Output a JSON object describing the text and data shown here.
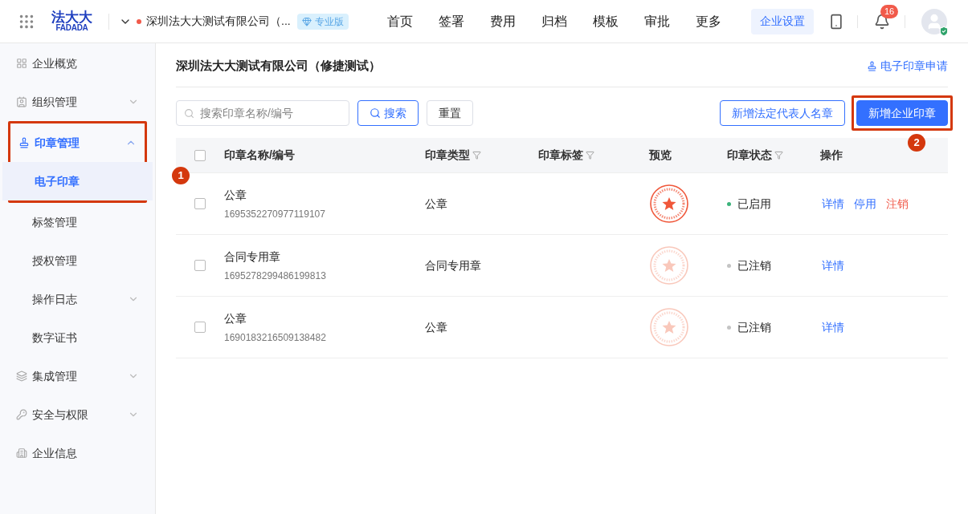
{
  "header": {
    "logo": {
      "top": "法大大",
      "bottom": "FADADA"
    },
    "company": "深圳法大大测试有限公司（...",
    "edition": "专业版",
    "nav": [
      {
        "label": "首页",
        "selected": false
      },
      {
        "label": "签署",
        "selected": false
      },
      {
        "label": "费用",
        "selected": false
      },
      {
        "label": "归档",
        "selected": false
      },
      {
        "label": "模板",
        "selected": false
      },
      {
        "label": "审批",
        "selected": false
      },
      {
        "label": "更多",
        "selected": false
      }
    ],
    "settings": "企业设置",
    "notifications": "16"
  },
  "sidebar": {
    "items": [
      {
        "label": "企业概览",
        "selected": false
      },
      {
        "label": "组织管理",
        "selected": false,
        "expanded": false
      },
      {
        "label": "印章管理",
        "selected": true,
        "expanded": true,
        "annotation": "1",
        "children": [
          {
            "label": "电子印章",
            "selected": true
          },
          {
            "label": "标签管理",
            "selected": false
          },
          {
            "label": "授权管理",
            "selected": false
          },
          {
            "label": "操作日志",
            "selected": false,
            "expanded": false
          },
          {
            "label": "数字证书",
            "selected": false
          }
        ]
      },
      {
        "label": "集成管理",
        "selected": false,
        "expanded": false
      },
      {
        "label": "安全与权限",
        "selected": false,
        "expanded": false
      },
      {
        "label": "企业信息",
        "selected": false
      }
    ]
  },
  "page": {
    "title": "深圳法大大测试有限公司（修捷测试）",
    "apply_link": "电子印章申请",
    "search": {
      "placeholder": "搜索印章名称/编号",
      "search_button": "搜索",
      "reset_button": "重置"
    },
    "buttons": [
      {
        "label": "新增法定代表人名章",
        "kind": "outline"
      },
      {
        "label": "新增企业印章",
        "kind": "primary",
        "annotation": "2"
      }
    ]
  },
  "table": {
    "all_checked": false,
    "columns": [
      {
        "label": "印章名称/编号",
        "filter": false
      },
      {
        "label": "印章类型",
        "filter": true
      },
      {
        "label": "印章标签",
        "filter": true
      },
      {
        "label": "预览",
        "filter": false
      },
      {
        "label": "印章状态",
        "filter": true
      },
      {
        "label": "操作",
        "filter": false
      }
    ],
    "rows": [
      {
        "checked": false,
        "name": "公章",
        "code": "1695352270977119107",
        "type": "公章",
        "enabled": true,
        "status": "已启用",
        "color": "#3bb37b",
        "actions": [
          {
            "label": "详情",
            "kind": "link"
          },
          {
            "label": "停用",
            "kind": "link"
          },
          {
            "label": "注销",
            "kind": "danger"
          }
        ]
      },
      {
        "checked": false,
        "name": "合同专用章",
        "code": "1695278299486199813",
        "type": "合同专用章",
        "enabled": false,
        "status": "已注销",
        "color": "#c4c4c4",
        "actions": [
          {
            "label": "详情",
            "kind": "link"
          }
        ]
      },
      {
        "checked": false,
        "name": "公章",
        "code": "1690183216509138482",
        "type": "公章",
        "enabled": false,
        "status": "已注销",
        "color": "#c4c4c4",
        "actions": [
          {
            "label": "详情",
            "kind": "link"
          }
        ]
      }
    ]
  }
}
